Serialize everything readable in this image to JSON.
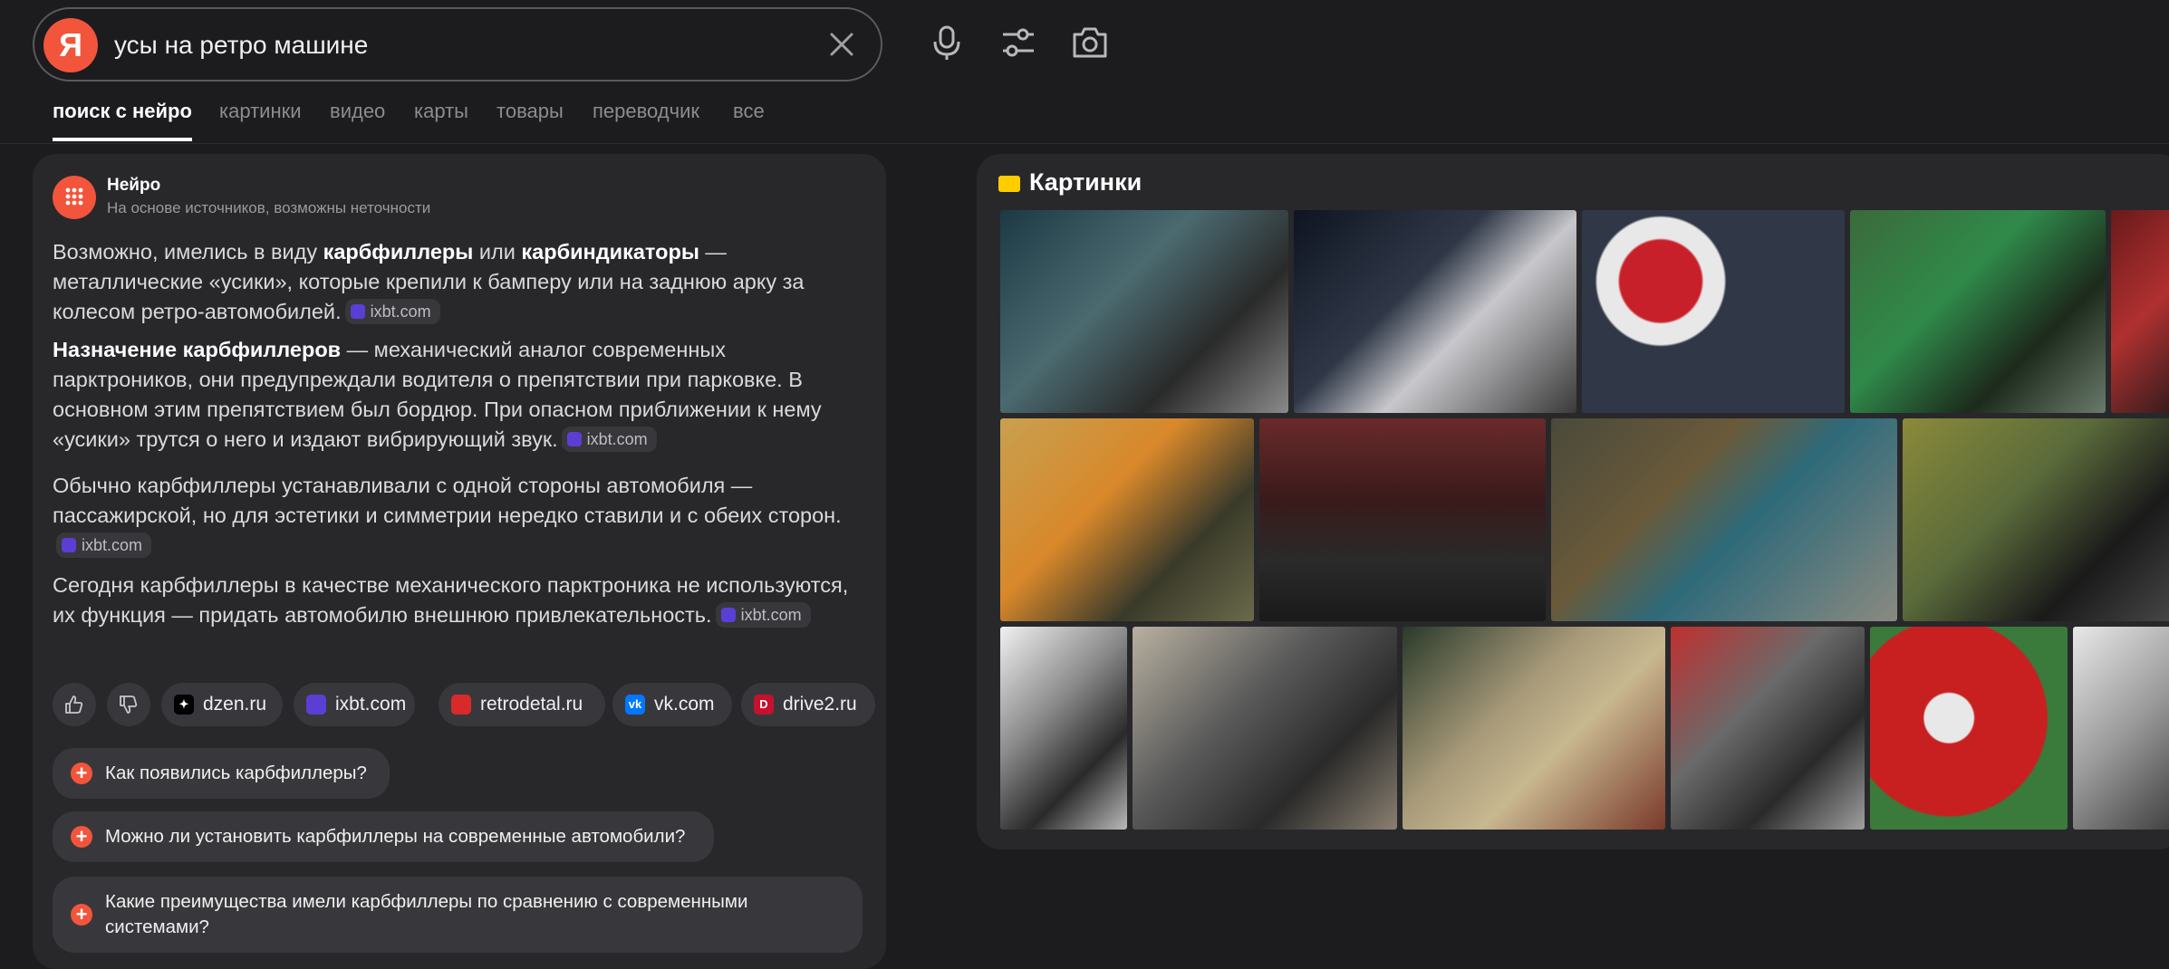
{
  "header": {
    "logo": "Я",
    "query": "усы на ретро машине",
    "icons": [
      "close-icon",
      "microphone-icon",
      "filters-icon",
      "camera-icon"
    ]
  },
  "tabs": [
    "поиск с нейро",
    "картинки",
    "видео",
    "карты",
    "товары",
    "переводчик",
    "все"
  ],
  "neuro": {
    "name": "Нейро",
    "subtitle": "На основе источников, возможны неточности",
    "p1": {
      "t1": "Возможно, имелись в виду ",
      "b1": "карбфиллеры",
      "t2": " или ",
      "b2": "карбиндикаторы",
      "t3": " — металлические «усики», которые крепили к бамперу или на заднюю арку за колесом ретро-автомобилей.",
      "src": "ixbt.com"
    },
    "p2": {
      "b1": "Назначение карбфиллеров",
      "t1": " — механический аналог современных парктроников, они предупреждали водителя о препятствии при парковке. В основном этим препятствием был бордюр. При опасном приближении к нему «усики» трутся о него и издают вибрирующий звук.",
      "src": "ixbt.com"
    },
    "p3": {
      "t1": "Обычно карбфиллеры устанавливали с одной стороны автомобиля — пассажирской, но для эстетики и симметрии нередко ставили и с обеих сторон.",
      "src": "ixbt.com"
    },
    "p4": {
      "t1": "Сегодня карбфиллеры в качестве механического парктроника не используются, их функция — придать автомобилю внешнюю привлекательность.",
      "src": "ixbt.com"
    },
    "sources": [
      "dzen.ru",
      "ixbt.com",
      "retrodetal.ru",
      "vk.com",
      "drive2.ru"
    ],
    "questions": [
      "Как появились карбфиллеры?",
      "Можно ли установить карбфиллеры на современные автомобили?",
      "Какие преимущества имели карбфиллеры по сравнению с современными системами?"
    ]
  },
  "images": {
    "title": "Картинки",
    "accent": "#ffcc00"
  },
  "colors": {
    "brand": "#f2553b",
    "bg": "#1c1c1e",
    "card": "#28282b",
    "chip": "#38383c"
  }
}
